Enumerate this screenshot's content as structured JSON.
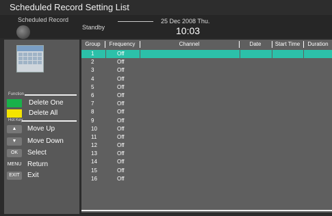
{
  "window": {
    "title": "Scheduled Record Setting List"
  },
  "header": {
    "mode": "Scheduled Record",
    "status": "Standby",
    "date": "25 Dec 2008 Thu.",
    "time": "10:03"
  },
  "sidebar": {
    "function_label": "Function",
    "functions": [
      {
        "label": "Delete One",
        "color": "#19b14a"
      },
      {
        "label": "Delete All",
        "color": "#f3e400"
      }
    ],
    "hotkey_label": "Hot Key",
    "hotkeys": [
      {
        "key": "▲",
        "label": "Move Up"
      },
      {
        "key": "▼",
        "label": "Move Down"
      },
      {
        "key": "OK",
        "label": "Select"
      },
      {
        "key": "MENU",
        "label": "Return"
      },
      {
        "key": "EXIT",
        "label": "Exit"
      }
    ]
  },
  "table": {
    "columns": [
      "Group",
      "Frequency",
      "Channel",
      "Date",
      "Start Time",
      "Duration"
    ],
    "rows": [
      {
        "group": "1",
        "frequency": "Off"
      },
      {
        "group": "2",
        "frequency": "Off"
      },
      {
        "group": "3",
        "frequency": "Off"
      },
      {
        "group": "4",
        "frequency": "Off"
      },
      {
        "group": "5",
        "frequency": "Off"
      },
      {
        "group": "6",
        "frequency": "Off"
      },
      {
        "group": "7",
        "frequency": "Off"
      },
      {
        "group": "8",
        "frequency": "Off"
      },
      {
        "group": "9",
        "frequency": "Off"
      },
      {
        "group": "10",
        "frequency": "Off"
      },
      {
        "group": "11",
        "frequency": "Off"
      },
      {
        "group": "12",
        "frequency": "Off"
      },
      {
        "group": "13",
        "frequency": "Off"
      },
      {
        "group": "14",
        "frequency": "Off"
      },
      {
        "group": "15",
        "frequency": "Off"
      },
      {
        "group": "16",
        "frequency": "Off"
      }
    ],
    "selected_color": "#2cc0a9"
  }
}
